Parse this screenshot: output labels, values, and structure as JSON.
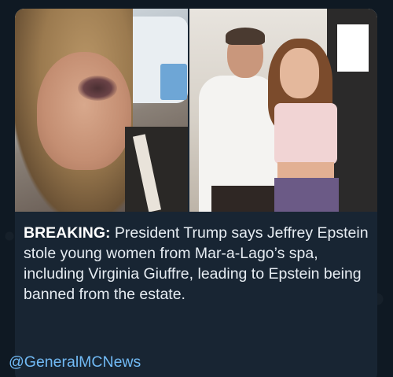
{
  "message": {
    "headline_label": "BREAKING:",
    "body_text": " President Trump says Jeffrey Epstein stole young women from Mar-a-Lago’s spa, including Virginia Giuffre, leading to Epstein being banned from the estate.",
    "channel_link": "@GeneralMCNews"
  },
  "media": {
    "photos": [
      {
        "name": "photo-left"
      },
      {
        "name": "photo-right"
      }
    ]
  },
  "colors": {
    "background": "#0f1923",
    "bubble": "#182533",
    "text": "#e6ecf2",
    "link": "#71baf5"
  }
}
